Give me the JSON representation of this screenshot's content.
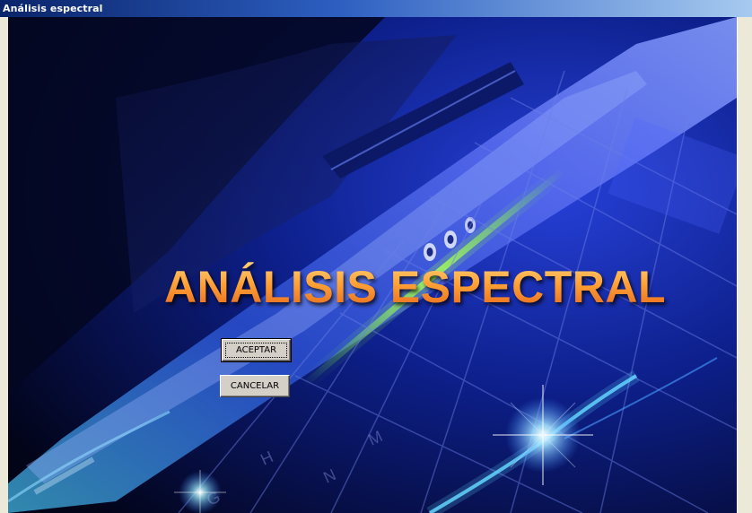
{
  "window": {
    "title": "Análisis espectral"
  },
  "splash": {
    "headline": "ANÁLISIS ESPECTRAL"
  },
  "buttons": {
    "accept_label": "ACEPTAR",
    "cancel_label": "CANCELAR"
  },
  "colors": {
    "titlebar_start": "#0a246a",
    "titlebar_end": "#a6caf0",
    "headline_orange": "#ff9c2a",
    "background_blue": "#0a1a7a",
    "glow_green": "#7cff3a"
  },
  "icons": {
    "background": "laptop-keyboard-image"
  }
}
